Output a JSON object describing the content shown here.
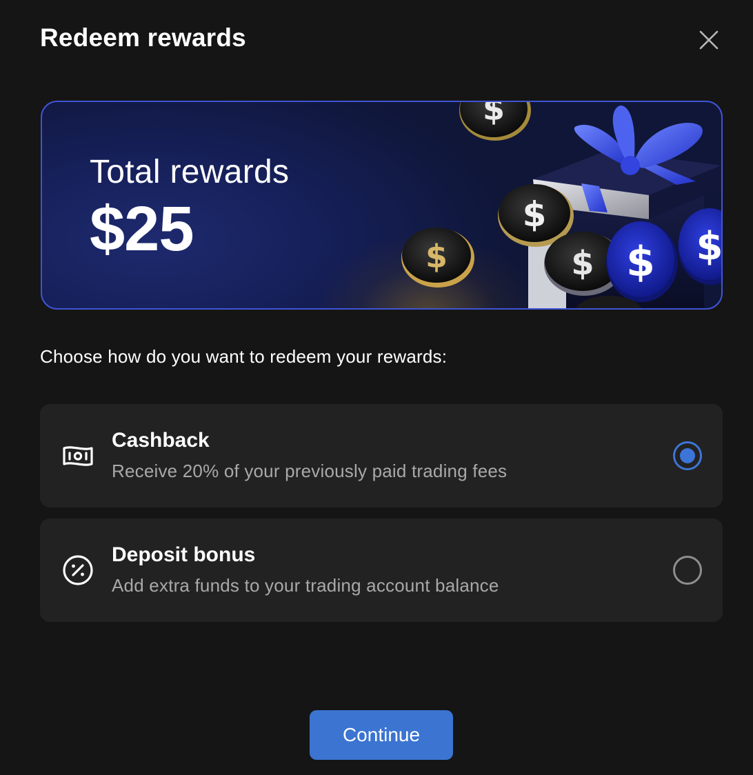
{
  "dialog": {
    "title": "Redeem rewards",
    "close_icon": "close-icon"
  },
  "banner": {
    "label": "Total rewards",
    "amount": "$25",
    "illustration": "gift-box-with-coins-illustration",
    "coin_symbol": "$",
    "accent_color": "#3f54d6"
  },
  "prompt": "Choose how do you want to redeem your rewards:",
  "options": [
    {
      "icon": "banknote-icon",
      "title": "Cashback",
      "description": "Receive 20% of your previously paid trading fees",
      "selected": true
    },
    {
      "icon": "percent-circle-icon",
      "title": "Deposit bonus",
      "description": "Add extra funds to your trading account balance",
      "selected": false
    }
  ],
  "footer": {
    "continue_label": "Continue"
  },
  "colors": {
    "background": "#151515",
    "card": "#222222",
    "accent": "#3b74d1",
    "muted_text": "#a9a9a9"
  }
}
